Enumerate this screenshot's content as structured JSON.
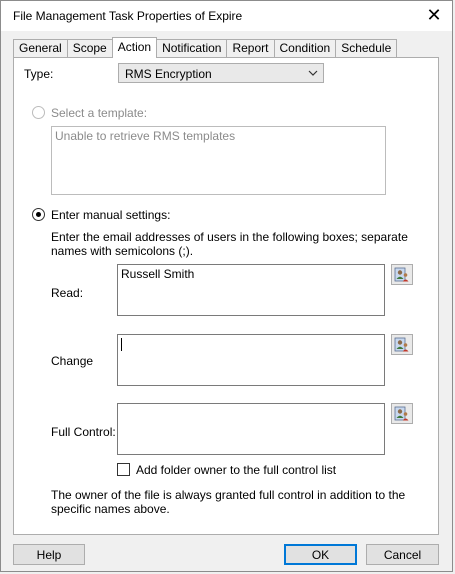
{
  "window": {
    "title": "File Management Task Properties of Expire",
    "close_glyph": "✕"
  },
  "tabs": [
    {
      "label": "General",
      "active": false
    },
    {
      "label": "Scope",
      "active": false
    },
    {
      "label": "Action",
      "active": true
    },
    {
      "label": "Notification",
      "active": false
    },
    {
      "label": "Report",
      "active": false
    },
    {
      "label": "Condition",
      "active": false
    },
    {
      "label": "Schedule",
      "active": false
    }
  ],
  "action": {
    "type_label": "Type:",
    "type_value": "RMS Encryption",
    "template_radio_label": "Select a template:",
    "template_placeholder": "Unable to retrieve RMS templates",
    "manual_radio_label": "Enter manual settings:",
    "instructions": "Enter the email addresses of users in the following boxes; separate names with semicolons (;).",
    "read_label": "Read:",
    "read_value": "Russell Smith",
    "change_label": "Change",
    "change_value": "",
    "full_control_label": "Full Control:",
    "full_control_value": "",
    "add_owner_label": "Add folder owner to the full control list",
    "add_owner_checked": false,
    "owner_note": "The owner of the file is always granted full control in addition to the specific names above."
  },
  "buttons": {
    "help": "Help",
    "ok": "OK",
    "cancel": "Cancel"
  },
  "colors": {
    "accent": "#0078d7",
    "disabled_text": "#8b8b8b"
  },
  "icons": {
    "address_book": "address-book-icon",
    "dropdown": "chevron-down-icon",
    "close": "close-icon"
  }
}
